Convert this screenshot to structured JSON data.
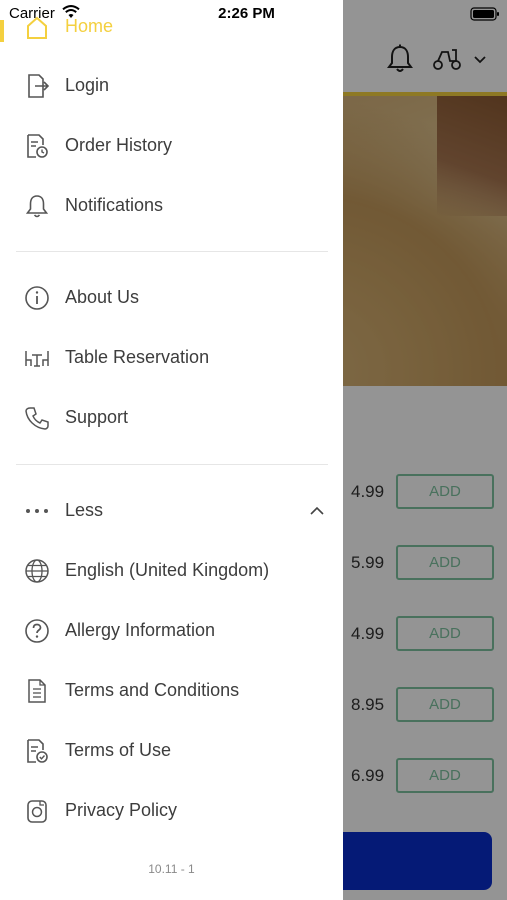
{
  "status_bar": {
    "carrier": "Carrier",
    "time": "2:26 PM"
  },
  "drawer": {
    "home_label": "Home",
    "items_group1": [
      {
        "label": "Login",
        "icon": "login-icon"
      },
      {
        "label": "Order History",
        "icon": "order-history-icon"
      },
      {
        "label": "Notifications",
        "icon": "bell-icon"
      }
    ],
    "items_group2": [
      {
        "label": "About Us",
        "icon": "info-icon"
      },
      {
        "label": "Table Reservation",
        "icon": "table-icon"
      },
      {
        "label": "Support",
        "icon": "phone-icon"
      }
    ],
    "less_label": "Less",
    "items_group3": [
      {
        "label": "English (United Kingdom)",
        "icon": "globe-icon"
      },
      {
        "label": "Allergy Information",
        "icon": "question-icon"
      },
      {
        "label": "Terms and Conditions",
        "icon": "document-icon"
      },
      {
        "label": "Terms of Use",
        "icon": "document-check-icon"
      },
      {
        "label": "Privacy Policy",
        "icon": "privacy-icon"
      }
    ],
    "version": "10.11 - 1"
  },
  "background": {
    "prices": [
      "4.99",
      "5.99",
      "4.99",
      "8.95",
      "6.99"
    ],
    "add_label": "ADD"
  },
  "colors": {
    "accent_yellow": "#f4d03f",
    "add_green": "#7fc3a0",
    "cta_blue": "#0a2dcc"
  }
}
